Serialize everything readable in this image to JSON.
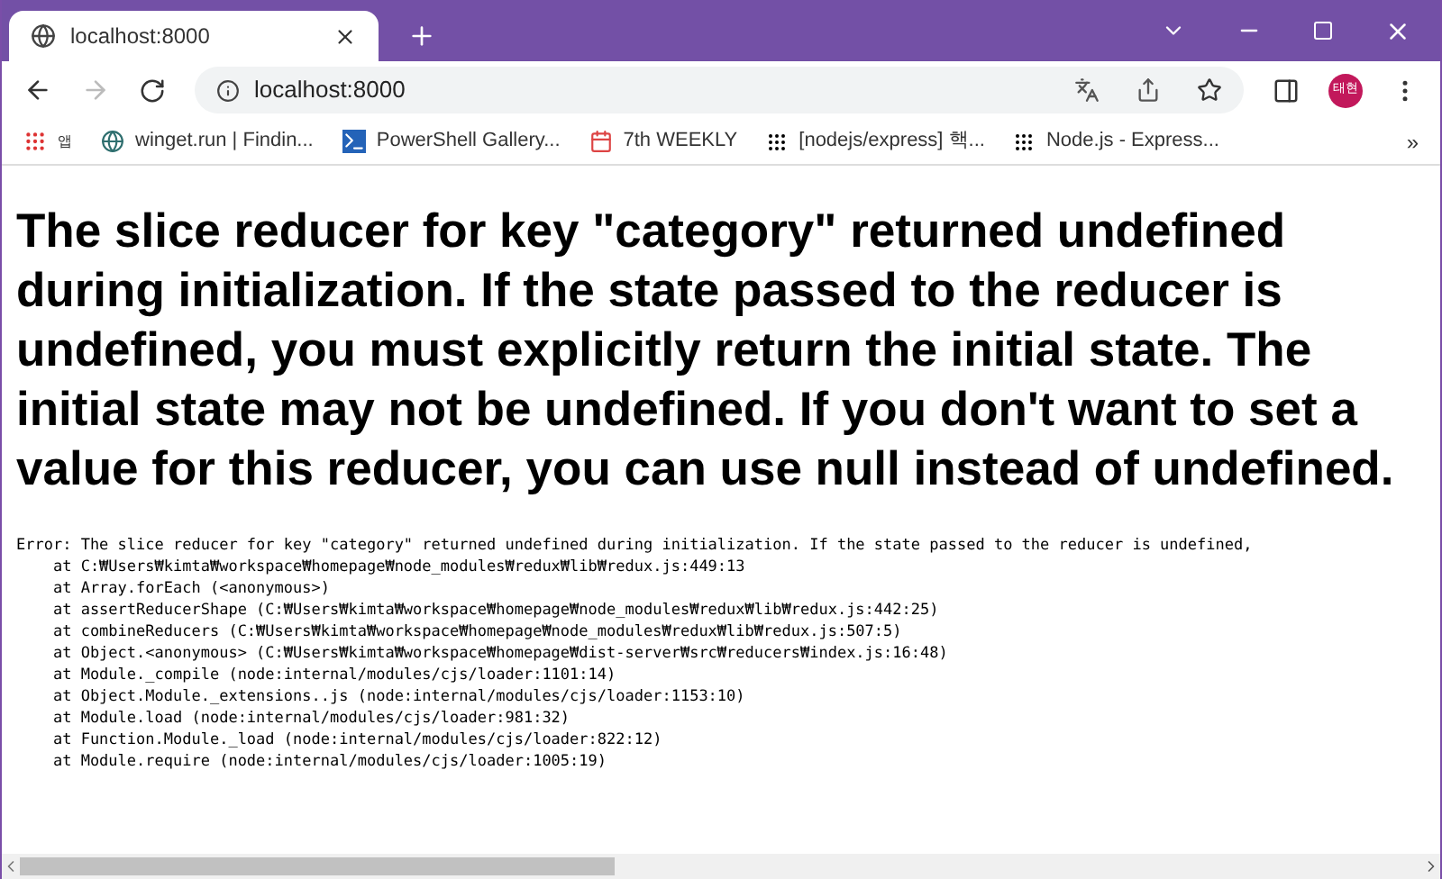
{
  "tab": {
    "title": "localhost:8000",
    "selected": true
  },
  "address": {
    "value": "localhost:8000"
  },
  "profile": {
    "initials": "태현"
  },
  "bookmarks": [
    {
      "label": "앱",
      "kind": "apps"
    },
    {
      "label": "winget.run | Findin...",
      "kind": "globe"
    },
    {
      "label": "PowerShell Gallery...",
      "kind": "powershell"
    },
    {
      "label": "7th WEEKLY",
      "kind": "calendar"
    },
    {
      "label": "[nodejs/express] 핵...",
      "kind": "dots"
    },
    {
      "label": "Node.js - Express...",
      "kind": "dots"
    }
  ],
  "more_bookmarks": "»",
  "page": {
    "heading": "The slice reducer for key \"category\" returned undefined during initialization. If the state passed to the reducer is undefined, you must explicitly return the initial state. The initial state may not be undefined. If you don't want to set a value for this reducer, you can use null instead of undefined.",
    "stack": [
      "Error: The slice reducer for key \"category\" returned undefined during initialization. If the state passed to the reducer is undefined,",
      "    at C:₩Users₩kimta₩workspace₩homepage₩node_modules₩redux₩lib₩redux.js:449:13",
      "    at Array.forEach (<anonymous>)",
      "    at assertReducerShape (C:₩Users₩kimta₩workspace₩homepage₩node_modules₩redux₩lib₩redux.js:442:25)",
      "    at combineReducers (C:₩Users₩kimta₩workspace₩homepage₩node_modules₩redux₩lib₩redux.js:507:5)",
      "    at Object.<anonymous> (C:₩Users₩kimta₩workspace₩homepage₩dist-server₩src₩reducers₩index.js:16:48)",
      "    at Module._compile (node:internal/modules/cjs/loader:1101:14)",
      "    at Object.Module._extensions..js (node:internal/modules/cjs/loader:1153:10)",
      "    at Module.load (node:internal/modules/cjs/loader:981:32)",
      "    at Function.Module._load (node:internal/modules/cjs/loader:822:12)",
      "    at Module.require (node:internal/modules/cjs/loader:1005:19)"
    ]
  }
}
